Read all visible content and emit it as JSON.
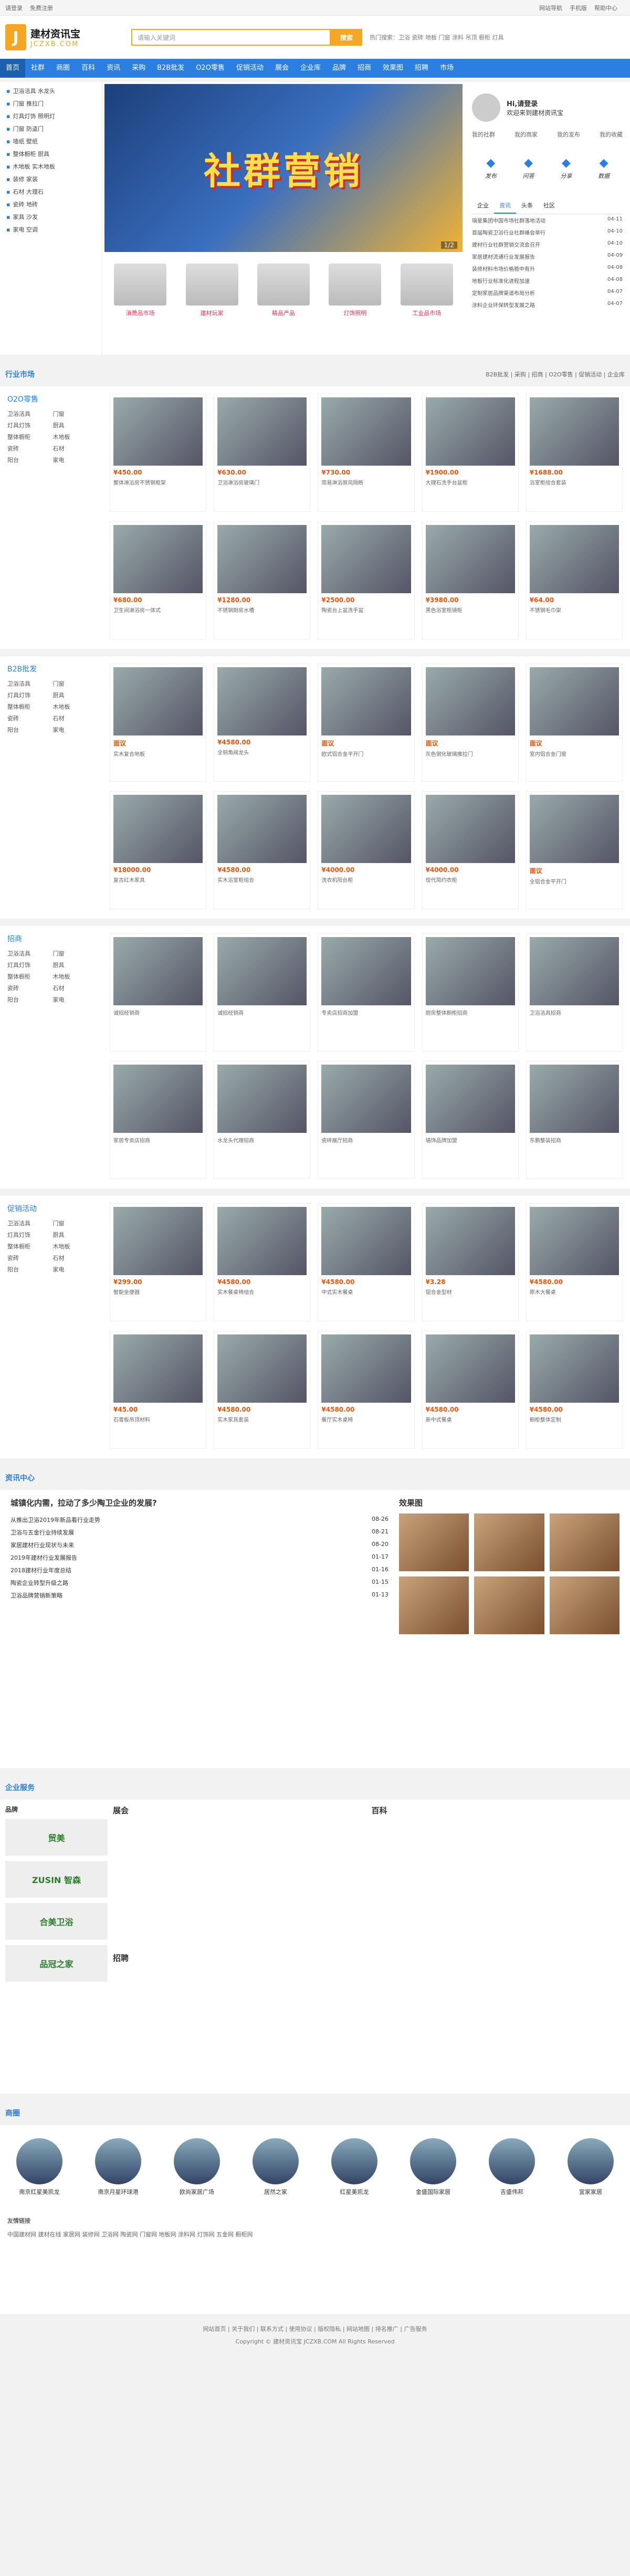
{
  "top": {
    "links": [
      "请登录",
      "免费注册",
      "网站导航",
      "手机版",
      "帮助中心"
    ]
  },
  "site": {
    "logo_text": "建材资讯宝",
    "logo_sub": "JCZXB.COM",
    "search_placeholder": "请输入关键词",
    "search_button": "搜索",
    "hot": "热门搜索：卫浴 瓷砖 地板 门窗 涂料 吊顶 橱柜 灯具"
  },
  "nav": [
    "首页",
    "社群",
    "商圈",
    "百科",
    "资讯",
    "采购",
    "B2B批发",
    "O2O零售",
    "促销活动",
    "展会",
    "企业库",
    "品牌",
    "招商",
    "效果图",
    "招聘",
    "市场"
  ],
  "cats": [
    "卫浴洁具 水龙头",
    "门窗 推拉门",
    "灯具灯饰 照明灯",
    "门窗 防盗门",
    "墙纸 壁纸",
    "整体橱柜 厨具",
    "木地板 实木地板",
    "装修 家装",
    "石材 大理石",
    "瓷砖 地砖",
    "家具 沙发",
    "家电 空调"
  ],
  "banner": {
    "text": "社群营销",
    "page": "1/2"
  },
  "prods": [
    "消费品市场",
    "建材玩家",
    "精品产品",
    "灯饰照明",
    "工业品市场"
  ],
  "user": {
    "name": "Hi,请登录",
    "sub": "欢迎来到建材资讯宝",
    "links": [
      "我的社群",
      "我的商家",
      "我的发布",
      "我的收藏"
    ],
    "quick": [
      "发布",
      "问答",
      "分享",
      "数据"
    ]
  },
  "ntabs": [
    "企业",
    "资讯",
    "头条",
    "社区"
  ],
  "nlist": [
    [
      "瑞星集团中国市场社群落地活动",
      "04-11"
    ],
    [
      "首届陶瓷卫浴行业社群峰会举行",
      "04-10"
    ],
    [
      "建材行业社群营销交流会召开",
      "04-10"
    ],
    [
      "家居建材流通行业发展报告",
      "04-09"
    ],
    [
      "装修材料市场价格稳中有升",
      "04-08"
    ],
    [
      "地板行业标准化进程加速",
      "04-08"
    ],
    [
      "定制家居品牌渠道布局分析",
      "04-07"
    ],
    [
      "涂料企业环保转型发展之路",
      "04-07"
    ]
  ],
  "markets": {
    "title": "行业市场",
    "right": "B2B批发 | 采购 | 招商 | O2O零售 | 促销活动 | 企业库"
  },
  "blocks": [
    {
      "title": "O2O零售",
      "cats": [
        "卫浴洁具",
        "门窗",
        "灯具灯饰",
        "厨具",
        "整体橱柜",
        "木地板",
        "瓷砖",
        "石材",
        "阳台",
        "家电"
      ],
      "items": [
        [
          "¥450.00",
          "整体淋浴房不锈钢框架"
        ],
        [
          "¥630.00",
          "卫浴淋浴房玻璃门"
        ],
        [
          "¥730.00",
          "简易淋浴屏风隔断"
        ],
        [
          "¥1900.00",
          "大理石洗手台盆柜"
        ],
        [
          "¥1688.00",
          "浴室柜组合套装"
        ],
        [
          "¥680.00",
          "卫生间淋浴房一体式"
        ],
        [
          "¥1280.00",
          "不锈钢厨房水槽"
        ],
        [
          "¥2500.00",
          "陶瓷台上盆洗手盆"
        ],
        [
          "¥3980.00",
          "黑色浴室柜镜柜"
        ],
        [
          "¥64.00",
          "不锈钢毛巾架"
        ]
      ]
    },
    {
      "title": "B2B批发",
      "cats": [
        "卫浴洁具",
        "门窗",
        "灯具灯饰",
        "厨具",
        "整体橱柜",
        "木地板",
        "瓷砖",
        "石材",
        "阳台",
        "家电"
      ],
      "items": [
        [
          "面议",
          "实木复合地板"
        ],
        [
          "¥4580.00",
          "全铜角阀龙头"
        ],
        [
          "面议",
          "欧式铝合金平开门"
        ],
        [
          "面议",
          "灰色钢化玻璃推拉门"
        ],
        [
          "面议",
          "室内铝合金门窗"
        ],
        [
          "¥18000.00",
          "复古红木家具"
        ],
        [
          "¥4580.00",
          "实木浴室柜组合"
        ],
        [
          "¥4000.00",
          "洗衣机阳台柜"
        ],
        [
          "¥4000.00",
          "现代简约衣柜"
        ],
        [
          "面议",
          "全铝合金平开门"
        ]
      ]
    },
    {
      "title": "招商",
      "cats": [
        "卫浴洁具",
        "门窗",
        "灯具灯饰",
        "厨具",
        "整体橱柜",
        "木地板",
        "瓷砖",
        "石材",
        "阳台",
        "家电"
      ],
      "items": [
        [
          "",
          "诚招经销商"
        ],
        [
          "",
          "诚招经销商"
        ],
        [
          "",
          "专卖店招商加盟"
        ],
        [
          "",
          "厨房整体橱柜招商"
        ],
        [
          "",
          "卫浴洁具招商"
        ],
        [
          "",
          "家居专卖店招商"
        ],
        [
          "",
          "水龙头代理招商"
        ],
        [
          "",
          "瓷砖展厅招商"
        ],
        [
          "",
          "墙饰品牌加盟"
        ],
        [
          "",
          "东鹏整装招商"
        ]
      ]
    },
    {
      "title": "促销活动",
      "cats": [
        "卫浴洁具",
        "门窗",
        "灯具灯饰",
        "厨具",
        "整体橱柜",
        "木地板",
        "瓷砖",
        "石材",
        "阳台",
        "家电"
      ],
      "items": [
        [
          "¥299.00",
          "智能坐便器"
        ],
        [
          "¥4580.00",
          "实木餐桌椅组合"
        ],
        [
          "¥4580.00",
          "中式实木餐桌"
        ],
        [
          "¥3.28",
          "铝合金型材"
        ],
        [
          "¥4580.00",
          "原木大餐桌"
        ],
        [
          "¥45.00",
          "石膏板吊顶材料"
        ],
        [
          "¥4580.00",
          "实木家具套装"
        ],
        [
          "¥4580.00",
          "餐厅实木桌椅"
        ],
        [
          "¥4580.00",
          "新中式餐桌"
        ],
        [
          "¥4580.00",
          "橱柜整体定制"
        ]
      ]
    }
  ],
  "news": {
    "title": "资讯中心",
    "headline": "城镇化内需，拉动了多少陶卫企业的发展?",
    "items": [
      [
        "从推出卫浴2019年新品看行业走势",
        "08-26"
      ],
      [
        "卫浴与五金行业持续发展",
        "08-21"
      ],
      [
        "家居建材行业现状与未来",
        "08-20"
      ],
      [
        "2019年建材行业发展报告",
        "01-17"
      ],
      [
        "2018建材行业年度总结",
        "01-16"
      ],
      [
        "陶瓷企业转型升级之路",
        "01-15"
      ],
      [
        "卫浴品牌营销新策略",
        "01-13"
      ]
    ],
    "pic_title": "效果图"
  },
  "service": {
    "title": "企业服务",
    "left": "品牌",
    "brands": [
      "贸美",
      "ZUSIN 智森",
      "合美卫浴",
      "品冠之家"
    ],
    "exhibit": "展会",
    "baike": "百科",
    "zhaopin": "招聘"
  },
  "show": {
    "title": "商圈",
    "items": [
      "南京红星美凯龙",
      "南京月星环球港",
      "欧尚家居广场",
      "居然之家",
      "红星美凯龙",
      "金盛国际家居",
      "吉盛伟邦",
      "宜家家居"
    ]
  },
  "links": {
    "title": "友情链接",
    "text": "中国建材网 建材在线 家居网 装修网 卫浴网 陶瓷网 门窗网 地板网 涂料网 灯饰网 五金网 橱柜网"
  },
  "footer": {
    "line1": "网站首页 | 关于我们 | 联系方式 | 使用协议 | 版权隐私 | 网站地图 | 排名推广 | 广告服务",
    "line2": "Copyright © 建材资讯宝 JCZXB.COM All Rights Reserved"
  }
}
